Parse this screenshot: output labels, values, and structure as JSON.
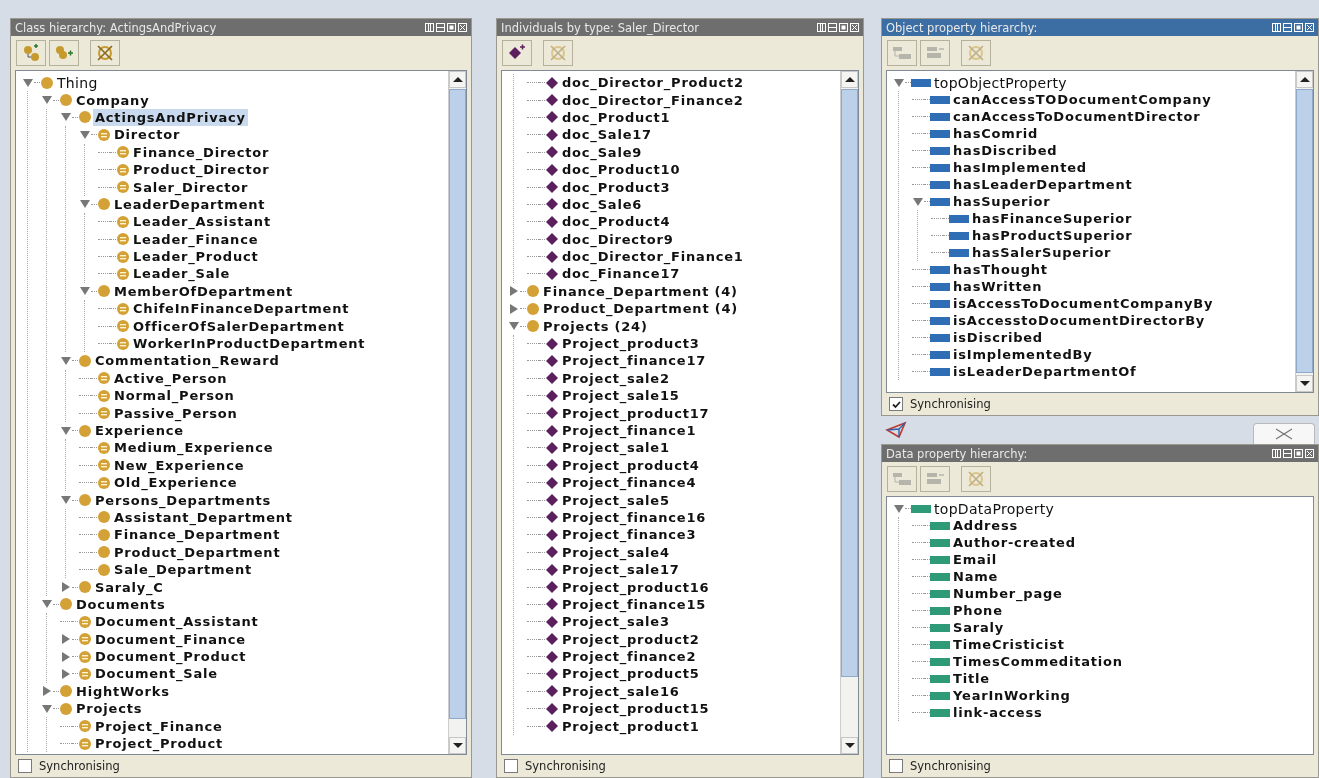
{
  "panels": [
    {
      "title": "Class hierarchy: ActingsAndPrivacy",
      "active": false,
      "toolbar": [
        {
          "kind": "add_subclass",
          "disabled": false
        },
        {
          "kind": "add_sibling",
          "disabled": false
        },
        {
          "kind": "delete",
          "disabled": false
        }
      ],
      "tree": [
        {
          "label": "Thing",
          "kind": "class",
          "builtin": true,
          "expanded": true,
          "selected": false,
          "children": [
            {
              "label": "Company",
              "kind": "class",
              "expanded": true,
              "selected": false,
              "children": [
                {
                  "label": "ActingsAndPrivacy",
                  "kind": "class",
                  "expanded": true,
                  "selected": true,
                  "children": [
                    {
                      "label": "Director",
                      "kind": "defined_class",
                      "expanded": true,
                      "selected": false,
                      "children": [
                        {
                          "label": "Finance_Director",
                          "kind": "defined_class",
                          "selected": false
                        },
                        {
                          "label": "Product_Director",
                          "kind": "defined_class",
                          "selected": false
                        },
                        {
                          "label": "Saler_Director",
                          "kind": "defined_class",
                          "selected": false
                        }
                      ]
                    },
                    {
                      "label": "LeaderDepartment",
                      "kind": "class",
                      "expanded": true,
                      "selected": false,
                      "children": [
                        {
                          "label": "Leader_Assistant",
                          "kind": "defined_class",
                          "selected": false
                        },
                        {
                          "label": "Leader_Finance",
                          "kind": "defined_class",
                          "selected": false
                        },
                        {
                          "label": "Leader_Product",
                          "kind": "defined_class",
                          "selected": false
                        },
                        {
                          "label": "Leader_Sale",
                          "kind": "defined_class",
                          "selected": false
                        }
                      ]
                    },
                    {
                      "label": "MemberOfDepartment",
                      "kind": "class",
                      "expanded": true,
                      "selected": false,
                      "children": [
                        {
                          "label": "ChifeInFinanceDepartment",
                          "kind": "defined_class",
                          "selected": false
                        },
                        {
                          "label": "OfficerOfSalerDepartment",
                          "kind": "defined_class",
                          "selected": false
                        },
                        {
                          "label": "WorkerInProductDepartment",
                          "kind": "defined_class",
                          "selected": false
                        }
                      ]
                    }
                  ]
                },
                {
                  "label": "Commentation_Reward",
                  "kind": "class",
                  "expanded": true,
                  "selected": false,
                  "children": [
                    {
                      "label": "Active_Person",
                      "kind": "defined_class",
                      "selected": false
                    },
                    {
                      "label": "Normal_Person",
                      "kind": "defined_class",
                      "selected": false
                    },
                    {
                      "label": "Passive_Person",
                      "kind": "defined_class",
                      "selected": false
                    }
                  ]
                },
                {
                  "label": "Experience",
                  "kind": "class",
                  "expanded": true,
                  "selected": false,
                  "children": [
                    {
                      "label": "Medium_Experience",
                      "kind": "defined_class",
                      "selected": false
                    },
                    {
                      "label": "New_Experience",
                      "kind": "defined_class",
                      "selected": false
                    },
                    {
                      "label": "Old_Experience",
                      "kind": "defined_class",
                      "selected": false
                    }
                  ]
                },
                {
                  "label": "Persons_Departments",
                  "kind": "class",
                  "expanded": true,
                  "selected": false,
                  "children": [
                    {
                      "label": "Assistant_Department",
                      "kind": "class",
                      "selected": false
                    },
                    {
                      "label": "Finance_Department",
                      "kind": "class",
                      "selected": false
                    },
                    {
                      "label": "Product_Department",
                      "kind": "class",
                      "selected": false
                    },
                    {
                      "label": "Sale_Department",
                      "kind": "class",
                      "selected": false
                    }
                  ]
                },
                {
                  "label": "Saraly_C",
                  "kind": "class",
                  "expanded": false,
                  "selected": false
                }
              ]
            },
            {
              "label": "Documents",
              "kind": "class",
              "expanded": true,
              "selected": false,
              "children": [
                {
                  "label": "Document_Assistant",
                  "kind": "defined_class",
                  "selected": false
                },
                {
                  "label": "Document_Finance",
                  "kind": "defined_class",
                  "expanded": false,
                  "selected": false
                },
                {
                  "label": "Document_Product",
                  "kind": "defined_class",
                  "expanded": false,
                  "selected": false
                },
                {
                  "label": "Document_Sale",
                  "kind": "defined_class",
                  "expanded": false,
                  "selected": false
                }
              ]
            },
            {
              "label": "HightWorks",
              "kind": "class",
              "expanded": false,
              "selected": false
            },
            {
              "label": "Projects",
              "kind": "class",
              "expanded": true,
              "selected": false,
              "children": [
                {
                  "label": "Project_Finance",
                  "kind": "defined_class",
                  "selected": false
                },
                {
                  "label": "Project_Product",
                  "kind": "defined_class",
                  "selected": false
                }
              ]
            }
          ]
        }
      ],
      "synchronising": {
        "label": "Synchronising",
        "checked": false
      }
    },
    {
      "title": "Individuals by type: Saler_Director",
      "active": false,
      "toolbar": [
        {
          "kind": "add_individual",
          "disabled": false
        },
        {
          "kind": "delete",
          "disabled": true
        }
      ],
      "continued_items": [
        {
          "label": "doc_Director_Product2",
          "kind": "individual",
          "selected": false
        },
        {
          "label": "doc_Director_Finance2",
          "kind": "individual",
          "selected": false
        },
        {
          "label": "doc_Product1",
          "kind": "individual",
          "selected": false
        },
        {
          "label": "doc_Sale17",
          "kind": "individual",
          "selected": false
        },
        {
          "label": "doc_Sale9",
          "kind": "individual",
          "selected": false
        },
        {
          "label": "doc_Product10",
          "kind": "individual",
          "selected": false
        },
        {
          "label": "doc_Product3",
          "kind": "individual",
          "selected": false
        },
        {
          "label": "doc_Sale6",
          "kind": "individual",
          "selected": false
        },
        {
          "label": "doc_Product4",
          "kind": "individual",
          "selected": false
        },
        {
          "label": "doc_Director9",
          "kind": "individual",
          "selected": false
        },
        {
          "label": "doc_Director_Finance1",
          "kind": "individual",
          "selected": false
        },
        {
          "label": "doc_Finance17",
          "kind": "individual",
          "selected": false
        }
      ],
      "tree": [
        {
          "label": "Finance_Department (4)",
          "kind": "class",
          "expanded": false,
          "selected": false
        },
        {
          "label": "Product_Department (4)",
          "kind": "class",
          "expanded": false,
          "selected": false
        },
        {
          "label": "Projects (24)",
          "kind": "class",
          "expanded": true,
          "selected": false,
          "children": [
            {
              "label": "Project_product3",
              "kind": "individual",
              "selected": false
            },
            {
              "label": "Project_finance17",
              "kind": "individual",
              "selected": false
            },
            {
              "label": "Project_sale2",
              "kind": "individual",
              "selected": false
            },
            {
              "label": "Project_sale15",
              "kind": "individual",
              "selected": false
            },
            {
              "label": "Project_product17",
              "kind": "individual",
              "selected": false
            },
            {
              "label": "Project_finance1",
              "kind": "individual",
              "selected": false
            },
            {
              "label": "Project_sale1",
              "kind": "individual",
              "selected": false
            },
            {
              "label": "Project_product4",
              "kind": "individual",
              "selected": false
            },
            {
              "label": "Project_finance4",
              "kind": "individual",
              "selected": false
            },
            {
              "label": "Project_sale5",
              "kind": "individual",
              "selected": false
            },
            {
              "label": "Project_finance16",
              "kind": "individual",
              "selected": false
            },
            {
              "label": "Project_finance3",
              "kind": "individual",
              "selected": false
            },
            {
              "label": "Project_sale4",
              "kind": "individual",
              "selected": false
            },
            {
              "label": "Project_sale17",
              "kind": "individual",
              "selected": false
            },
            {
              "label": "Project_product16",
              "kind": "individual",
              "selected": false
            },
            {
              "label": "Project_finance15",
              "kind": "individual",
              "selected": false
            },
            {
              "label": "Project_sale3",
              "kind": "individual",
              "selected": false
            },
            {
              "label": "Project_product2",
              "kind": "individual",
              "selected": false
            },
            {
              "label": "Project_finance2",
              "kind": "individual",
              "selected": false
            },
            {
              "label": "Project_product5",
              "kind": "individual",
              "selected": false
            },
            {
              "label": "Project_sale16",
              "kind": "individual",
              "selected": false
            },
            {
              "label": "Project_product15",
              "kind": "individual",
              "selected": false
            },
            {
              "label": "Project_product1",
              "kind": "individual",
              "selected": false
            }
          ]
        }
      ],
      "synchronising": {
        "label": "Synchronising",
        "checked": false
      }
    },
    {
      "title": "Object property hierarchy:",
      "active": true,
      "toolbar": [
        {
          "kind": "add_subproperty",
          "disabled": true
        },
        {
          "kind": "add_sibling_property",
          "disabled": true
        },
        {
          "kind": "delete",
          "disabled": true
        }
      ],
      "tree": [
        {
          "label": "topObjectProperty",
          "kind": "object_property",
          "builtin": true,
          "expanded": true,
          "selected": false,
          "children": [
            {
              "label": "canAccessTODocumentCompany",
              "kind": "object_property",
              "selected": false
            },
            {
              "label": "canAccessToDocumentDirector",
              "kind": "object_property",
              "selected": false
            },
            {
              "label": "hasComrid",
              "kind": "object_property",
              "selected": false
            },
            {
              "label": "hasDiscribed",
              "kind": "object_property",
              "selected": false
            },
            {
              "label": "hasImplemented",
              "kind": "object_property",
              "selected": false
            },
            {
              "label": "hasLeaderDepartment",
              "kind": "object_property",
              "selected": false
            },
            {
              "label": "hasSuperior",
              "kind": "object_property",
              "expanded": true,
              "selected": false,
              "children": [
                {
                  "label": "hasFinanceSuperior",
                  "kind": "object_property",
                  "selected": false
                },
                {
                  "label": "hasProductSuperior",
                  "kind": "object_property",
                  "selected": false
                },
                {
                  "label": "hasSalerSuperior",
                  "kind": "object_property",
                  "selected": false
                }
              ]
            },
            {
              "label": "hasThought",
              "kind": "object_property",
              "selected": false
            },
            {
              "label": "hasWritten",
              "kind": "object_property",
              "selected": false
            },
            {
              "label": "isAccessToDocumentCompanyBy",
              "kind": "object_property",
              "selected": false
            },
            {
              "label": "isAccesstoDocumentDirectorBy",
              "kind": "object_property",
              "selected": false
            },
            {
              "label": "isDiscribed",
              "kind": "object_property",
              "selected": false
            },
            {
              "label": "isImplementedBy",
              "kind": "object_property",
              "selected": false
            },
            {
              "label": "isLeaderDepartmentOf",
              "kind": "object_property",
              "selected": false
            }
          ]
        }
      ],
      "synchronising": {
        "label": "Synchronising",
        "checked": true
      }
    },
    {
      "title": "Data property hierarchy:",
      "active": false,
      "toolbar": [
        {
          "kind": "add_subproperty",
          "disabled": true
        },
        {
          "kind": "add_sibling_property",
          "disabled": true
        },
        {
          "kind": "delete",
          "disabled": true
        }
      ],
      "tree": [
        {
          "label": "topDataProperty",
          "kind": "data_property",
          "builtin": true,
          "expanded": true,
          "selected": false,
          "children": [
            {
              "label": "Address",
              "kind": "data_property",
              "selected": false
            },
            {
              "label": "Author-created",
              "kind": "data_property",
              "selected": false
            },
            {
              "label": "Email",
              "kind": "data_property",
              "selected": false
            },
            {
              "label": "Name",
              "kind": "data_property",
              "selected": false
            },
            {
              "label": "Number_page",
              "kind": "data_property",
              "selected": false
            },
            {
              "label": "Phone",
              "kind": "data_property",
              "selected": false
            },
            {
              "label": "Saraly",
              "kind": "data_property",
              "selected": false
            },
            {
              "label": "TimeCristicist",
              "kind": "data_property",
              "selected": false
            },
            {
              "label": "TimesCommeditation",
              "kind": "data_property",
              "selected": false
            },
            {
              "label": "Title",
              "kind": "data_property",
              "selected": false
            },
            {
              "label": "YearInWorking",
              "kind": "data_property",
              "selected": false
            },
            {
              "label": "link-access",
              "kind": "data_property",
              "selected": false
            }
          ]
        }
      ],
      "synchronising": {
        "label": "Synchronising",
        "checked": false
      }
    }
  ]
}
